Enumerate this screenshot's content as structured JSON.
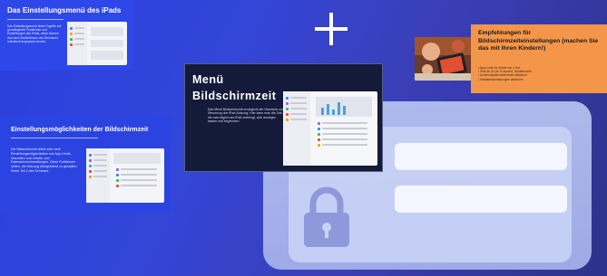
{
  "card_ipad_menu": {
    "title": "Das Einstellungsmenü des iPads",
    "text": "Das Einstellungsmenü bietet Zugriffe auf grundlegende Funktionen und Einstellungen des iPads, diese können dort nach Bedürfnissen des Benutzers individuell angepasst werden."
  },
  "card_settings_options": {
    "title": "Einstellungsmöglichkeiten der Bildschirmzeit",
    "text": "Die Bildschirmzeit bietet sehr viele Einstellungsmöglichkeiten wie App-Limits, Auszeiten und Inhalts- und Datenschutzeinstellungen. Diese Funktionen helfen, die Nutzung übergreifend zu gestalten. Siehe Teil 1 des Seminars."
  },
  "card_screentime_menu": {
    "title_line1": "Menü",
    "title_line2": "Bildschirmzeit",
    "text": "Das Menü Bildschirmzeit ermöglicht die Übersicht und Steuerung der iPad-Nutzung. Hier kann man die Zeit, die man täglich am iPad verbringt, sich anzeigen lassen und begrenzen."
  },
  "card_recommendations": {
    "title": "Empfehlungen für Bildschirmzeiteinstellungen (machen Sie das mit Ihren Kindern!)",
    "bullets": [
      "• App-Limits für Spiele von 1 Std.",
      "• iPad ab 20 Uhr in Auszeit, Schlafenszeit",
      "• Kommunikationssicherheit aktivieren",
      "• Inhaltsbeschränkungen aktivieren"
    ]
  },
  "icons": {
    "plus": "plus-icon",
    "lock": "lock-icon"
  },
  "colors": {
    "background": "#3346d8",
    "card_blue": "#2d47e8",
    "card_dark": "#141a3a",
    "card_orange": "#f3964a",
    "illustration": "#b9c4f2"
  }
}
